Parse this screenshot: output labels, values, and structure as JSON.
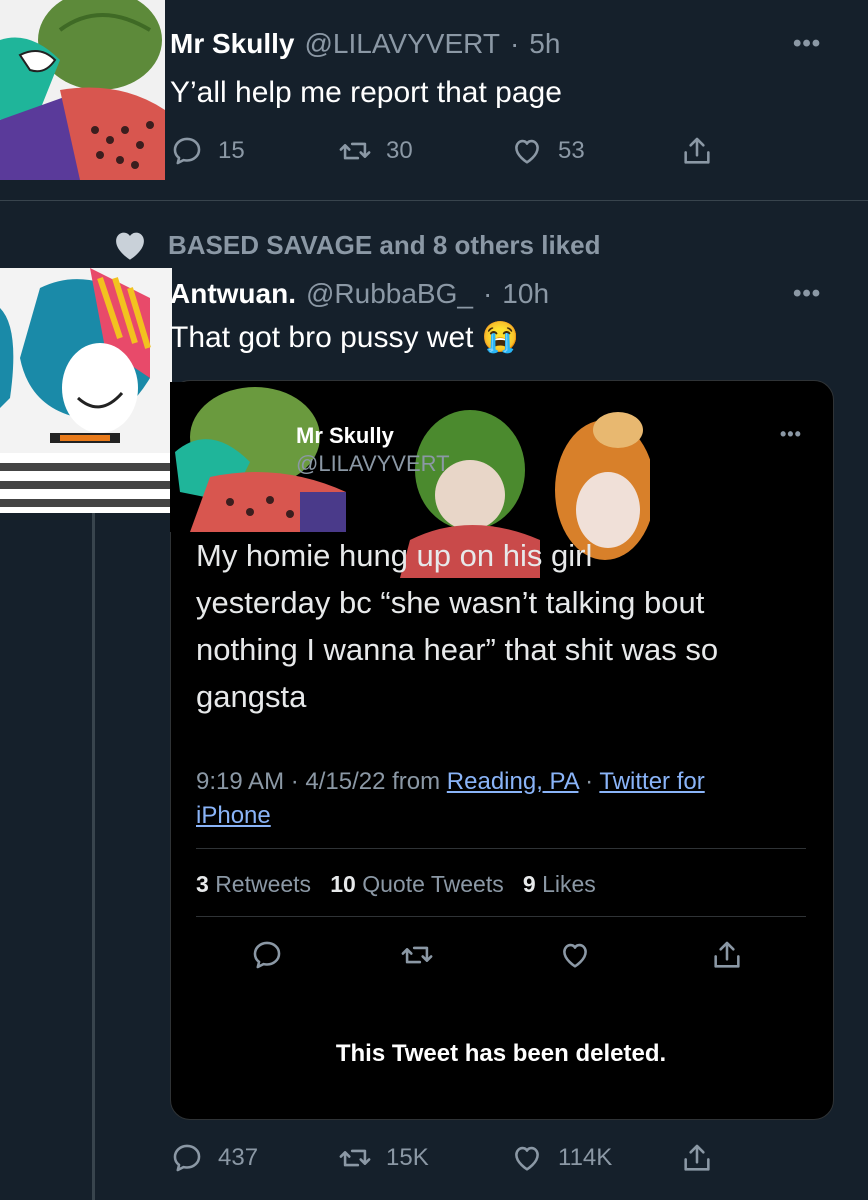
{
  "tweet1": {
    "name": "Mr Skully",
    "handle": "@LILAVYVERT",
    "time": "5h",
    "text": "Y’all help me report that page",
    "replies": "15",
    "retweets": "30",
    "likes": "53"
  },
  "tweet2": {
    "social_context": "BASED SAVAGE and 8 others liked",
    "name": "Antwuan.",
    "handle": "@RubbaBG_",
    "time": "10h",
    "text": "That got bro pussy wet",
    "emoji": "😭",
    "replies": "437",
    "retweets": "15K",
    "likes": "114K"
  },
  "quote": {
    "name": "Mr Skully",
    "handle": "@LILAVYVERT",
    "text_lines": [
      "My homie hung up on his girl",
      "yesterday bc “she wasn’t talking bout",
      "nothing I wanna hear” that shit was so",
      "gangsta"
    ],
    "meta_time": "9:19 AM · 4/15/22 from",
    "location": "Reading, PA",
    "sep": "·",
    "source_line1": "Twitter for",
    "source_line2": "iPhone",
    "retweets_count": "3",
    "retweets_label": "Retweets",
    "quotes_count": "10",
    "quotes_label": "Quote Tweets",
    "likes_count": "9",
    "likes_label": "Likes",
    "deleted_notice": "This Tweet has been deleted."
  }
}
